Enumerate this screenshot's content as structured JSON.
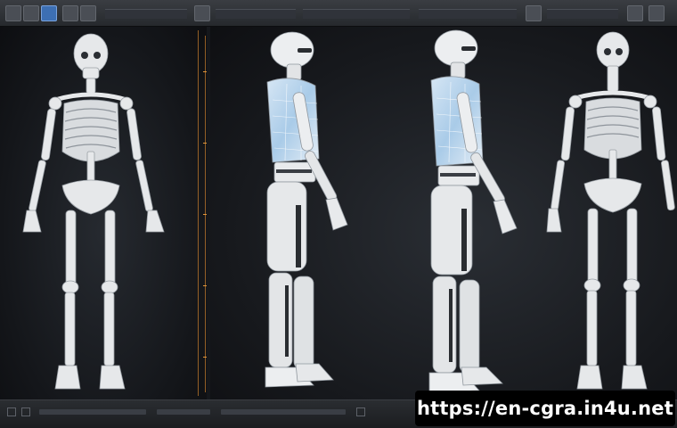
{
  "app": {
    "viewport_views": [
      "skeleton-front",
      "armored-side-1",
      "armored-side-2",
      "skeleton-front-right"
    ]
  },
  "colors": {
    "toolbar_bg": "#2f3236",
    "viewport_bg": "#17191d",
    "bone": "#e8eaec",
    "armor_blue": "#bcd7ee",
    "guide_orange": "#c07a2c"
  },
  "watermark": {
    "text": "https://en-cgra.in4u.net"
  }
}
